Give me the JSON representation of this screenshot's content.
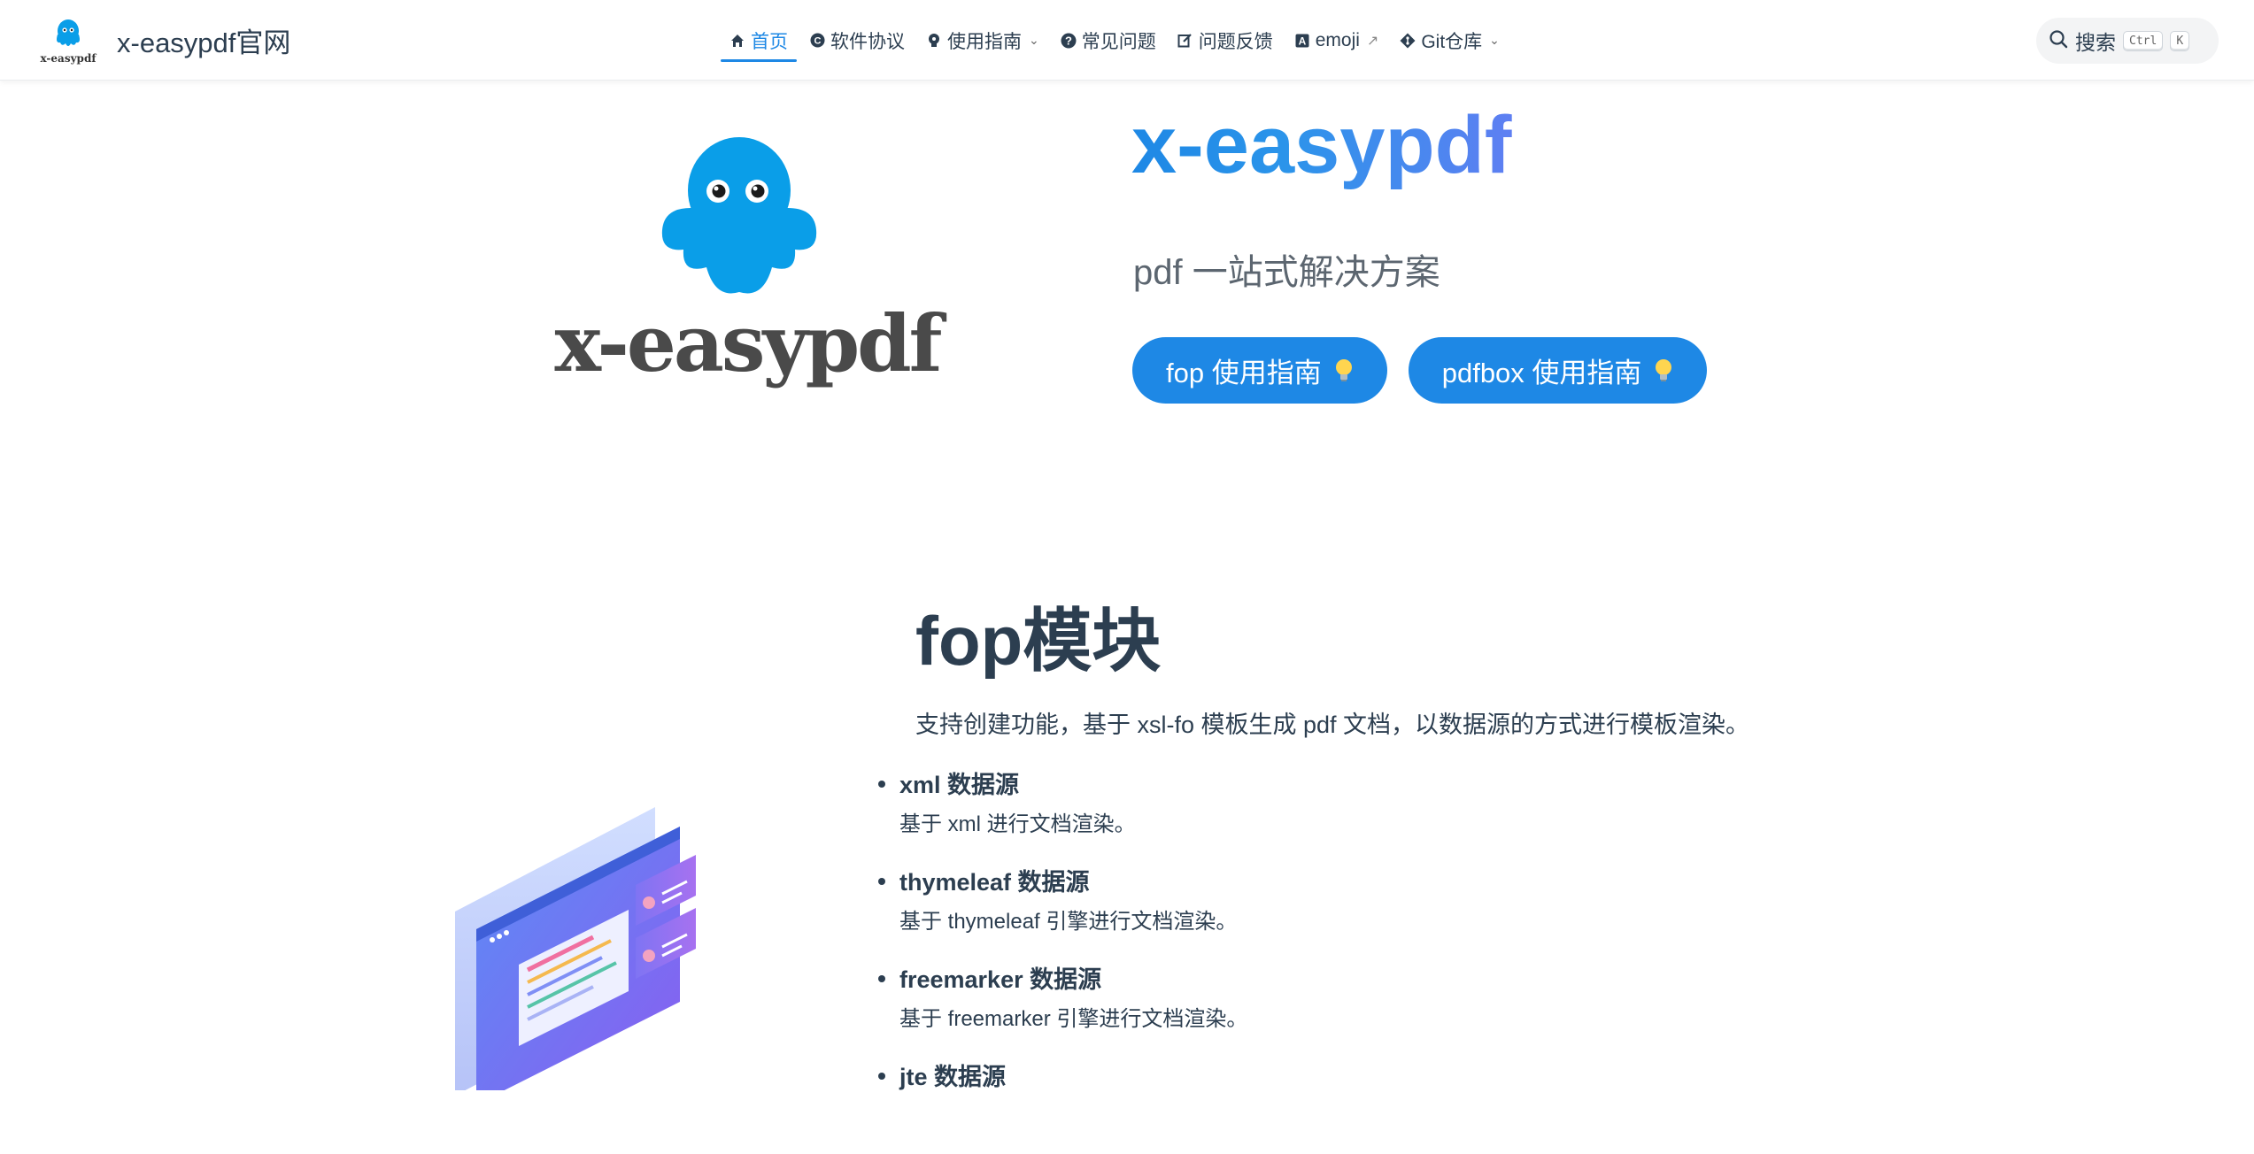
{
  "navbar": {
    "brand_title": "x-easypdf官网",
    "brand_logo_text": "x-easypdf",
    "links": [
      {
        "label": "首页",
        "icon": "home-icon"
      },
      {
        "label": "软件协议",
        "icon": "copyright-icon"
      },
      {
        "label": "使用指南",
        "icon": "bulb-icon",
        "dropdown": true
      },
      {
        "label": "常见问题",
        "icon": "question-icon"
      },
      {
        "label": "问题反馈",
        "icon": "edit-icon"
      },
      {
        "label": "emoji",
        "icon": "emoji-icon",
        "external": true
      },
      {
        "label": "Git仓库",
        "icon": "git-icon",
        "dropdown": true
      }
    ],
    "search": {
      "label": "搜索",
      "key1": "Ctrl",
      "key2": "K"
    }
  },
  "hero": {
    "logo_text": "x-easypdf",
    "title": "x-easypdf",
    "description": "pdf 一站式解决方案",
    "actions": [
      {
        "label": "fop 使用指南"
      },
      {
        "label": "pdfbox 使用指南"
      }
    ]
  },
  "feature": {
    "title": "fop模块",
    "description": "支持创建功能，基于 xsl-fo 模板生成 pdf 文档，以数据源的方式进行模板渲染。",
    "items": [
      {
        "name": "xml 数据源",
        "desc": "基于 xml 进行文档渲染。"
      },
      {
        "name": "thymeleaf 数据源",
        "desc": "基于 thymeleaf 引擎进行文档渲染。"
      },
      {
        "name": "freemarker 数据源",
        "desc": "基于 freemarker 引擎进行文档渲染。"
      },
      {
        "name": "jte 数据源",
        "desc": ""
      }
    ]
  },
  "colors": {
    "accent": "#1e88e5",
    "text": "#2c3e50",
    "mascot": "#0a9ee8"
  }
}
